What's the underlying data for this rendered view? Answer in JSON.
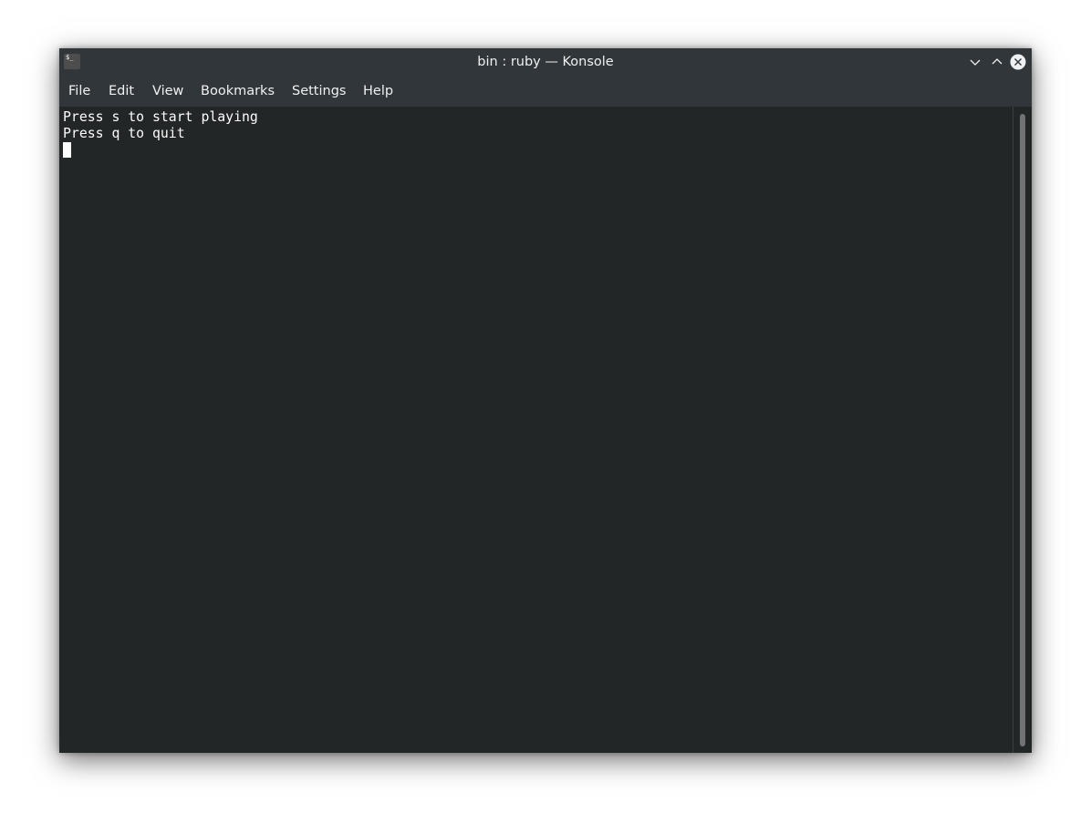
{
  "window": {
    "title": "bin : ruby — Konsole",
    "icon": "terminal-icon",
    "icon_glyph": "$_",
    "controls": {
      "minimize": "chevron-down-icon",
      "maximize": "chevron-up-icon",
      "close": "close-icon"
    }
  },
  "menubar": {
    "items": [
      {
        "label": "File"
      },
      {
        "label": "Edit"
      },
      {
        "label": "View"
      },
      {
        "label": "Bookmarks"
      },
      {
        "label": "Settings"
      },
      {
        "label": "Help"
      }
    ]
  },
  "terminal": {
    "lines": [
      "Press s to start playing",
      "Press q to quit"
    ]
  },
  "colors": {
    "titlebar": "#31363b",
    "terminal_bg": "#232627",
    "terminal_fg": "#fcfcfc"
  }
}
